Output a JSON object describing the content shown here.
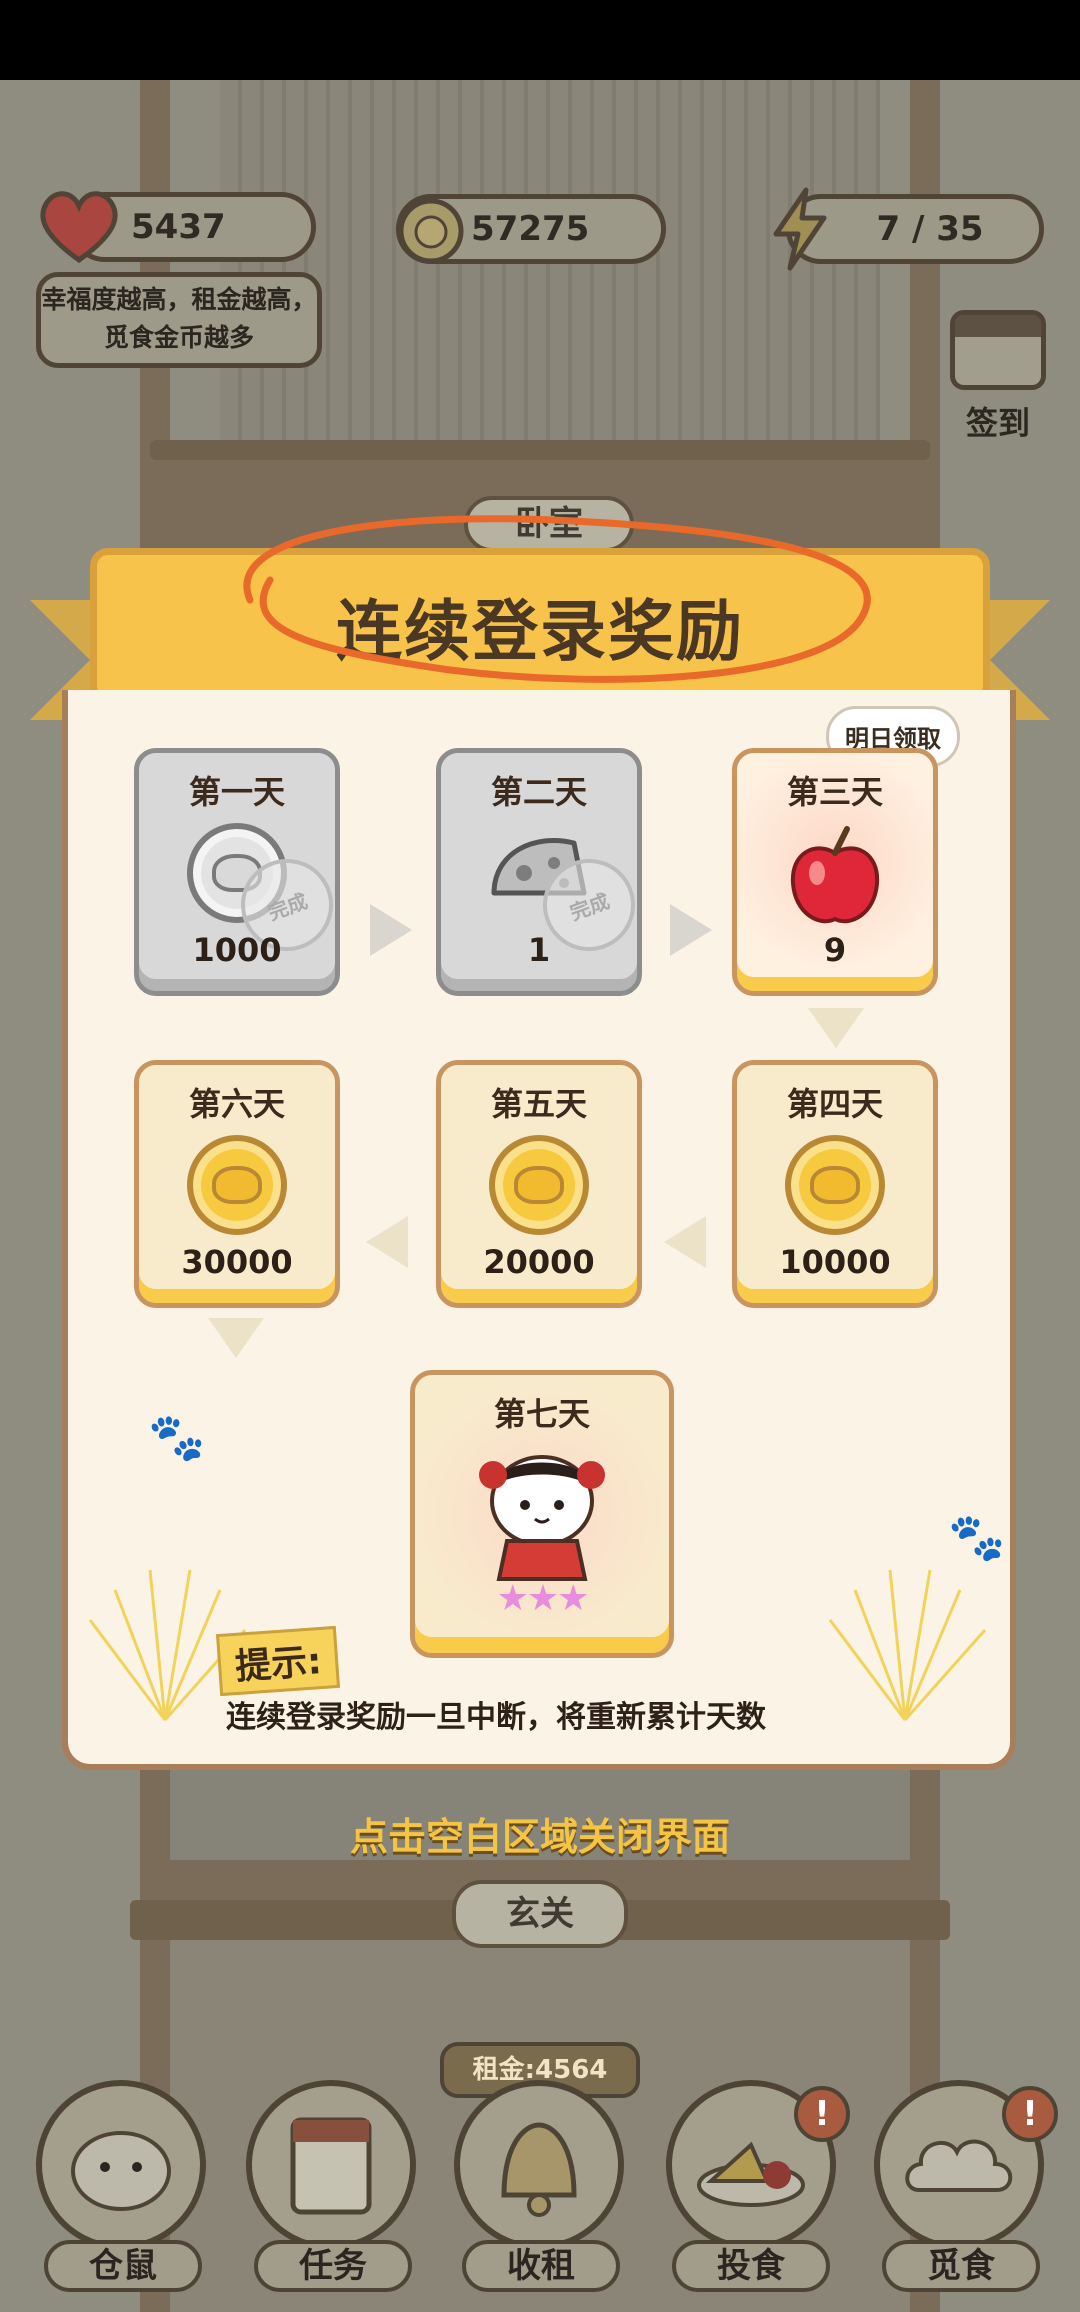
{
  "hud": {
    "hearts": "5437",
    "coins": "57275",
    "energy": "7 / 35",
    "happiness_tip": "幸福度越高，租金越高，觅食金币越多",
    "signin_label": "签到"
  },
  "room_labels": {
    "top": "卧室",
    "bottom": "玄关"
  },
  "dialog": {
    "title": "连续登录奖励",
    "tomorrow_badge": "明日领取",
    "days": [
      {
        "title": "第一天",
        "reward": "coin",
        "qty": "1000",
        "status": "done",
        "stamp": "完成"
      },
      {
        "title": "第二天",
        "reward": "cheese",
        "qty": "1",
        "status": "done",
        "stamp": "完成"
      },
      {
        "title": "第三天",
        "reward": "apple",
        "qty": "9",
        "status": "next"
      },
      {
        "title": "第四天",
        "reward": "coin",
        "qty": "10000",
        "status": "pending"
      },
      {
        "title": "第五天",
        "reward": "coin",
        "qty": "20000",
        "status": "pending"
      },
      {
        "title": "第六天",
        "reward": "coin",
        "qty": "30000",
        "status": "pending"
      },
      {
        "title": "第七天",
        "reward": "hamster-costume",
        "stars": "★★★",
        "status": "pending"
      }
    ],
    "hint_label": "提示:",
    "hint_text": "连续登录奖励一旦中断，将重新累计天数",
    "close_hint": "点击空白区域关闭界面"
  },
  "bottom_bar": {
    "rent": "租金:4564",
    "buttons": [
      "仓鼠",
      "任务",
      "收租",
      "投食",
      "觅食"
    ],
    "alert": "!"
  },
  "colors": {
    "banner": "#f7c34a",
    "panel": "#fbf3e6",
    "highlight_scribble": "#e8692a",
    "close_hint": "#f4c545"
  }
}
